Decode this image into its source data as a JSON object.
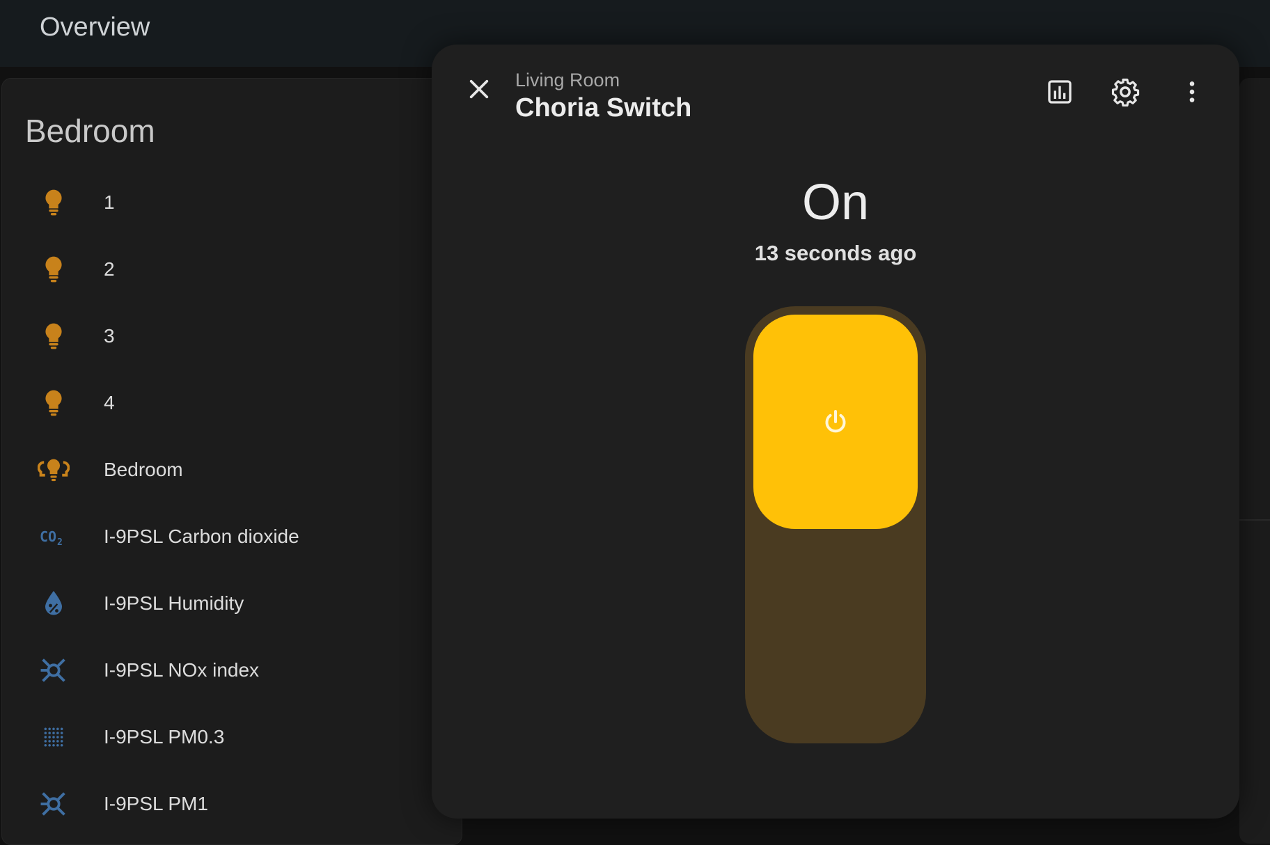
{
  "header": {
    "title": "Overview"
  },
  "card": {
    "title": "Bedroom",
    "items": [
      {
        "label": "1",
        "icon": "lightbulb-icon"
      },
      {
        "label": "2",
        "icon": "lightbulb-icon"
      },
      {
        "label": "3",
        "icon": "lightbulb-icon"
      },
      {
        "label": "4",
        "icon": "lightbulb-icon"
      },
      {
        "label": "Bedroom",
        "icon": "lightbulb-group-icon"
      },
      {
        "label": "I-9PSL Carbon dioxide",
        "icon": "co2-icon"
      },
      {
        "label": "I-9PSL Humidity",
        "icon": "humidity-icon"
      },
      {
        "label": "I-9PSL NOx index",
        "icon": "molecule-icon"
      },
      {
        "label": "I-9PSL PM0.3",
        "icon": "dots-grid-icon"
      },
      {
        "label": "I-9PSL PM1",
        "icon": "molecule-icon"
      }
    ]
  },
  "dialog": {
    "area": "Living Room",
    "title": "Choria Switch",
    "state": "On",
    "last_changed": "13 seconds ago",
    "toggle_on": true
  },
  "colors": {
    "accent": "#ffc107",
    "track": "#4a3b21",
    "light_icon": "#c8821b",
    "sensor_icon": "#3f6fa3"
  }
}
